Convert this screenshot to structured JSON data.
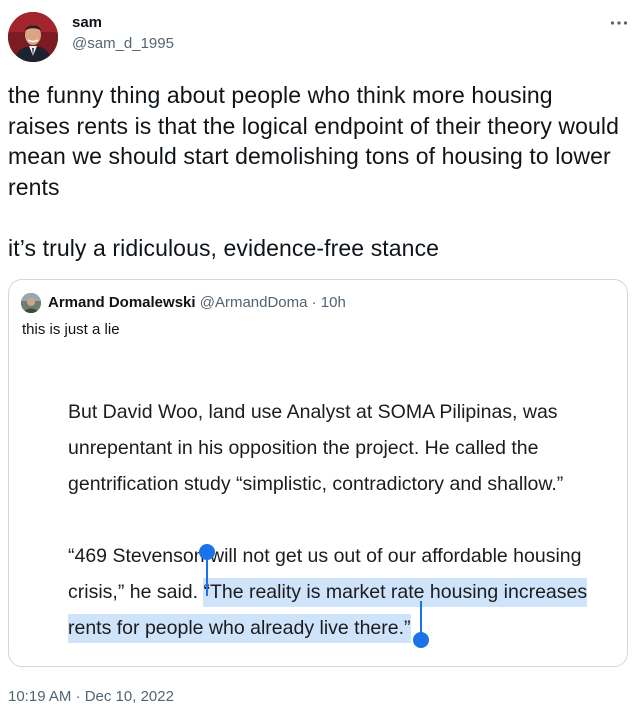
{
  "author": {
    "display_name": "sam",
    "handle": "@sam_d_1995",
    "avatar_icon": "profile-photo"
  },
  "tweet": {
    "text": "the funny thing about people who think more housing raises rents is that the logical endpoint of their theory would mean we should start demolishing tons of housing to lower rents\n\nit’s truly a ridiculous, evidence-free stance",
    "timestamp": "10:19 AM · Dec 10, 2022"
  },
  "quoted_tweet": {
    "display_name": "Armand Domalewski",
    "handle_time": "@ArmandDoma · 10h",
    "text": "this is just a lie",
    "image_text": {
      "paragraph1": "But David Woo, land use Analyst at SOMA Pilipinas, was unrepentant in his opposition the project. He called the gentrification study “simplistic, contradictory and shallow.”",
      "paragraph2_plain": "“469 Stevenson will not get us out of our affordable housing crisis,” he said. ",
      "paragraph2_highlighted": "“The reality is market rate housing increases rents for people who already live there.”"
    }
  },
  "colors": {
    "text_primary": "#0f1419",
    "text_secondary": "#536471",
    "card_border": "#cfd9de",
    "selection_highlight": "#cfe3fb",
    "selection_handle": "#1a73e8"
  }
}
